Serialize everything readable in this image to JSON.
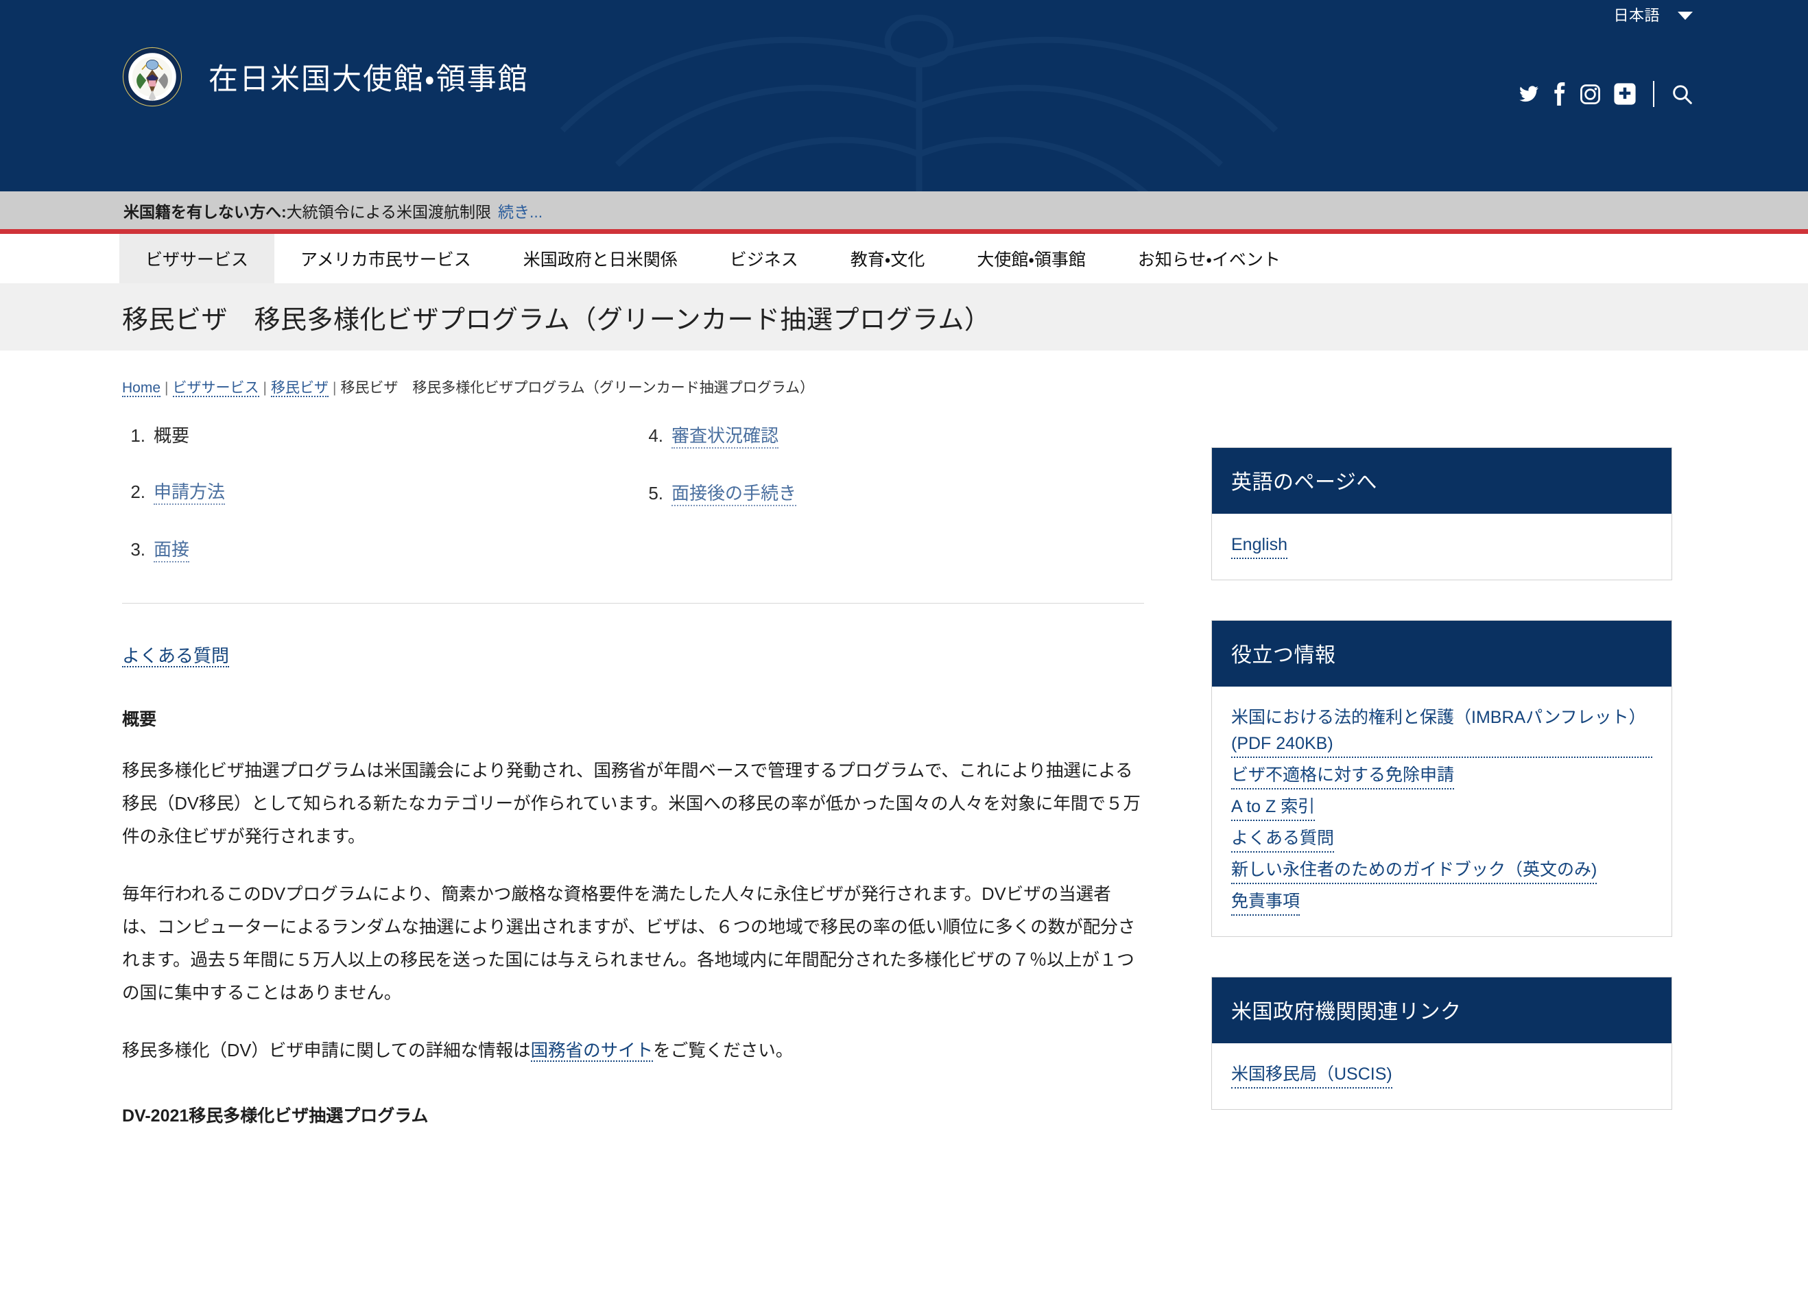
{
  "header": {
    "language_label": "日本語",
    "brand_title": "在日米国大使館・領事館",
    "seal_alt": "us-department-of-state-seal",
    "social": [
      {
        "name": "twitter-icon",
        "label": "Twitter"
      },
      {
        "name": "facebook-icon",
        "label": "Facebook"
      },
      {
        "name": "instagram-icon",
        "label": "Instagram"
      },
      {
        "name": "flickr-plus-icon",
        "label": "Share"
      },
      {
        "name": "search-icon",
        "label": "Search"
      }
    ]
  },
  "alert": {
    "strong": "米国籍を有しない方へ:",
    "text": " 大統領令による米国渡航制限",
    "more": "続き..."
  },
  "nav": {
    "items": [
      {
        "label": "ビザサービス",
        "active": true
      },
      {
        "label": "アメリカ市民サービス",
        "active": false
      },
      {
        "label": "米国政府と日米関係",
        "active": false
      },
      {
        "label": "ビジネス",
        "active": false
      },
      {
        "label": "教育・文化",
        "active": false
      },
      {
        "label": "大使館・領事館",
        "active": false
      },
      {
        "label": "お知らせ・イベント",
        "active": false
      }
    ]
  },
  "page": {
    "title": "移民ビザ　移民多様化ビザプログラム（グリーンカード抽選プログラム）"
  },
  "breadcrumb": {
    "items": [
      {
        "label": "Home",
        "link": true
      },
      {
        "label": "ビザサービス",
        "link": true
      },
      {
        "label": "移民ビザ",
        "link": true
      },
      {
        "label": "移民ビザ　移民多様化ビザプログラム（グリーンカード抽選プログラム）",
        "link": false
      }
    ],
    "separator": "|"
  },
  "index": {
    "left": [
      {
        "num": "1.",
        "label": "概要",
        "link": false
      },
      {
        "num": "2.",
        "label": "申請方法",
        "link": true
      },
      {
        "num": "3.",
        "label": "面接",
        "link": true
      }
    ],
    "right": [
      {
        "num": "4.",
        "label": "審査状況確認",
        "link": true
      },
      {
        "num": "5.",
        "label": "面接後の手続き",
        "link": true
      }
    ]
  },
  "main": {
    "faq_link": "よくある質問",
    "heading_overview": "概要",
    "paragraph1": "移民多様化ビザ抽選プログラムは米国議会により発動され、国務省が年間ベースで管理するプログラムで、これにより抽選による移民（DV移民）として知られる新たなカテゴリーが作られています。米国への移民の率が低かった国々の人々を対象に年間で５万件の永住ビザが発行されます。",
    "paragraph2": "毎年行われるこのDVプログラムにより、簡素かつ厳格な資格要件を満たした人々に永住ビザが発行されます。DVビザの当選者は、コンピューターによるランダムな抽選により選出されますが、ビザは、６つの地域で移民の率の低い順位に多くの数が配分されます。過去５年間に５万人以上の移民を送った国には与えられません。各地域内に年間配分された多様化ビザの７％以上が１つの国に集中することはありません。",
    "paragraph3_before": "移民多様化（DV）ビザ申請に関しての詳細な情報は",
    "paragraph3_link": "国務省のサイト",
    "paragraph3_after": "をご覧ください。",
    "heading_dv2021": "DV-2021移民多様化ビザ抽選プログラム"
  },
  "sidebar": {
    "boxes": [
      {
        "title": "英語のページへ",
        "links": [
          "English"
        ]
      },
      {
        "title": "役立つ情報",
        "links": [
          "米国における法的権利と保護（IMBRAパンフレット）(PDF 240KB)",
          "ビザ不適格に対する免除申請",
          "A to Z 索引",
          "よくある質問",
          "新しい永住者のためのガイドブック（英文のみ)",
          "免責事項"
        ]
      },
      {
        "title": "米国政府機関関連リンク",
        "links": [
          "米国移民局（USCIS)"
        ]
      }
    ]
  },
  "colors": {
    "header_blue": "#0a3161",
    "alert_gray": "#cccccc",
    "alert_red_rule": "#cf3339",
    "link_blue": "#15457e",
    "title_band": "#f0f0f0"
  }
}
